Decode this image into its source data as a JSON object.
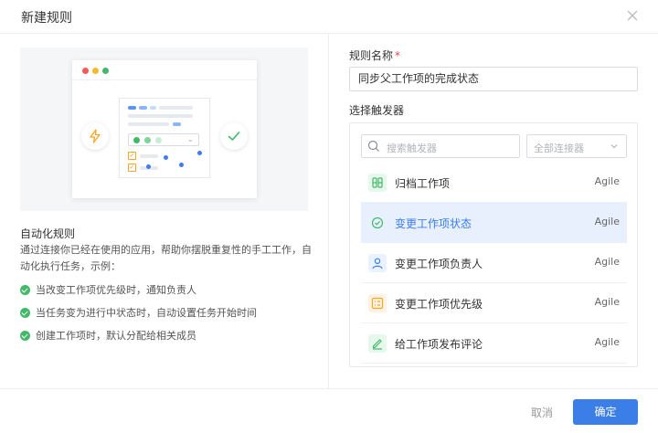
{
  "dialog": {
    "title": "新建规则",
    "close_icon": "close-icon"
  },
  "left": {
    "illustration_icons": [
      "lightning-icon",
      "check-circle-icon"
    ],
    "heading": "自动化规则",
    "description": "通过连接你已经在使用的应用，帮助你摆脱重复性的手工工作，自动化执行任务，示例：",
    "features": [
      "当改变工作项优先级时，通知负责人",
      "当任务变为进行中状态时，自动设置任务开始时间",
      "创建工作项时，默认分配给相关成员"
    ]
  },
  "form": {
    "name_label": "规则名称",
    "required_mark": "*",
    "name_value": "同步父工作项的完成状态",
    "trigger_label": "选择触发器",
    "search_placeholder": "搜索触发器",
    "connector_select": "全部连接器",
    "triggers": [
      {
        "label": "归档工作项",
        "source": "Agile",
        "icon": "archive-icon",
        "active": false
      },
      {
        "label": "变更工作项状态",
        "source": "Agile",
        "icon": "status-check-icon",
        "active": true
      },
      {
        "label": "变更工作项负责人",
        "source": "Agile",
        "icon": "user-icon",
        "active": false
      },
      {
        "label": "变更工作项优先级",
        "source": "Agile",
        "icon": "priority-list-icon",
        "active": false
      },
      {
        "label": "给工作项发布评论",
        "source": "Agile",
        "icon": "pencil-icon",
        "active": false
      }
    ]
  },
  "footer": {
    "cancel_label": "取消",
    "ok_label": "确定"
  },
  "colors": {
    "primary": "#3b7ee8",
    "active_bg": "#e8f0fd",
    "success": "#43b968",
    "required": "#e5484d"
  }
}
